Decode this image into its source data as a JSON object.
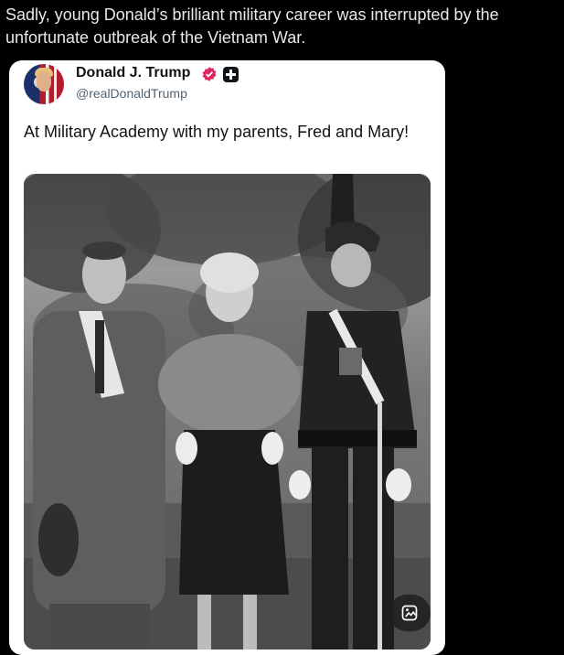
{
  "post": {
    "text": "Sadly, young Donald’s brilliant military career was interrupted by the unfortunate outbreak of the Vietnam War."
  },
  "quoted_tweet": {
    "author_name": "Donald J. Trump",
    "handle": "@realDonaldTrump",
    "text": "At Military Academy with my parents, Fred and Mary!",
    "avatar_icon": "avatar-image",
    "verified_icon": "verified-badge-icon",
    "plus_icon": "plus-badge-icon",
    "photo_action_icon": "photo-view-icon"
  },
  "colors": {
    "background": "#000000",
    "card": "#ffffff",
    "text_primary": "#e7e9ea",
    "verified_pink": "#e0245e"
  }
}
